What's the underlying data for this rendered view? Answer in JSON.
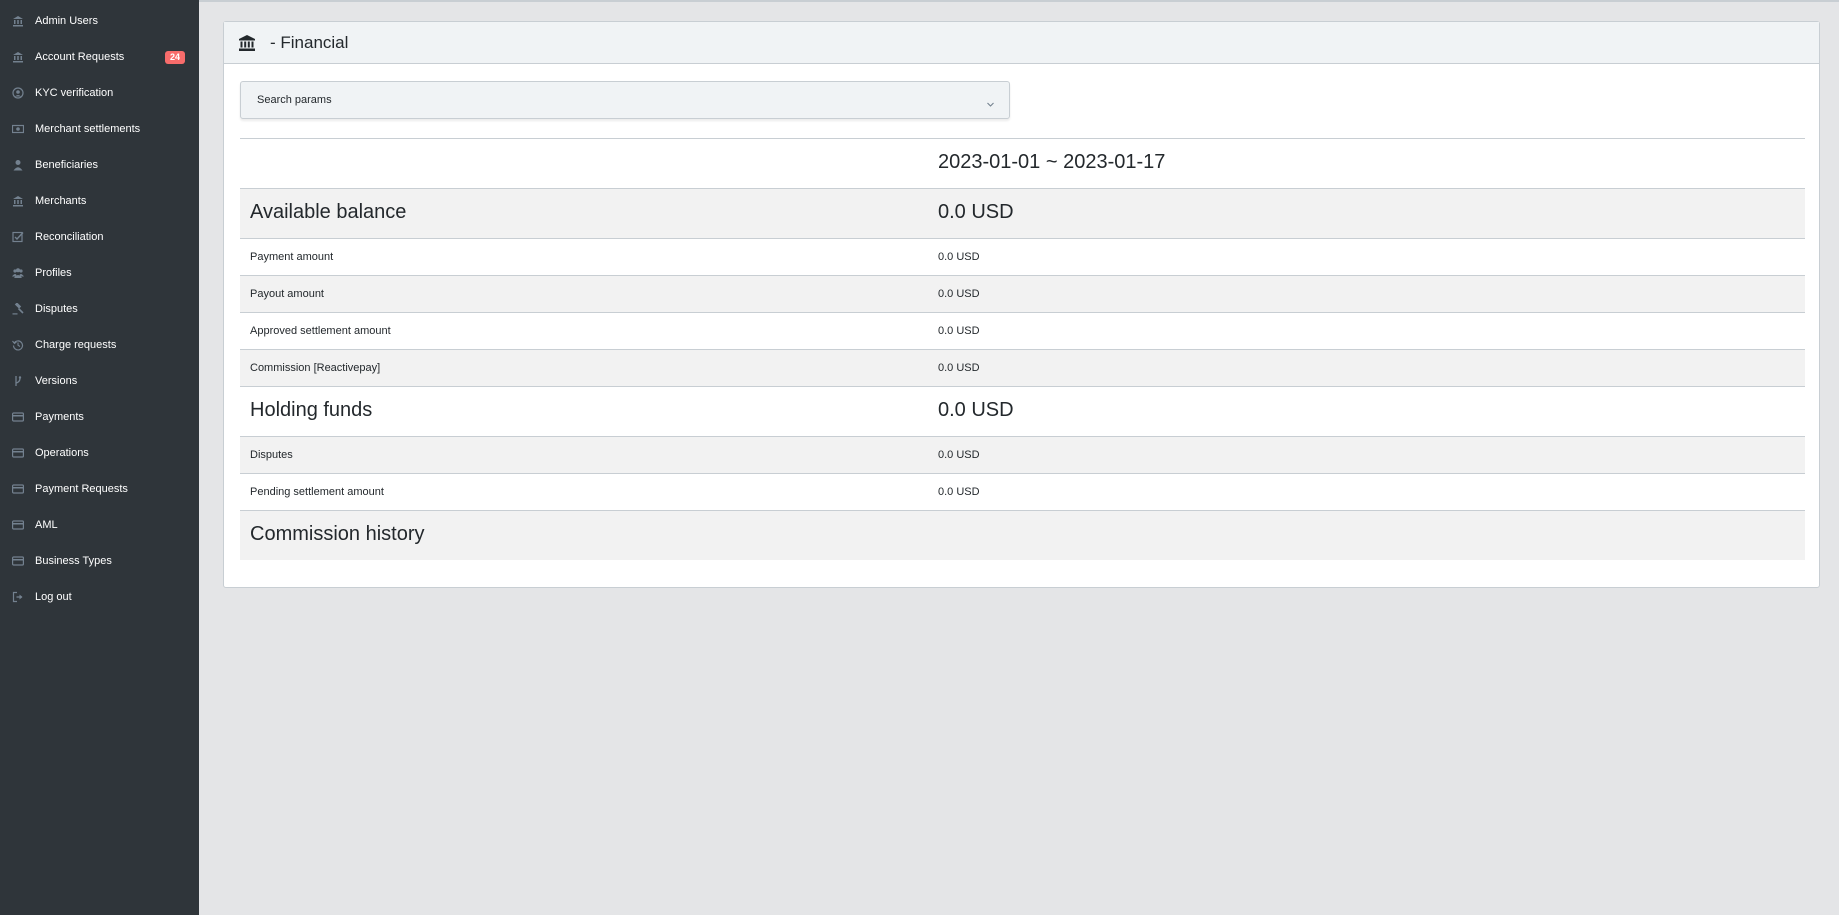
{
  "sidebar": {
    "items": [
      {
        "label": "Admin Users",
        "icon": "bank-icon"
      },
      {
        "label": "Account Requests",
        "icon": "bank-icon",
        "badge": "24"
      },
      {
        "label": "KYC verification",
        "icon": "user-circle-icon"
      },
      {
        "label": "Merchant settlements",
        "icon": "money-icon"
      },
      {
        "label": "Beneficiaries",
        "icon": "user-icon"
      },
      {
        "label": "Merchants",
        "icon": "bank-icon"
      },
      {
        "label": "Reconciliation",
        "icon": "check-square-icon"
      },
      {
        "label": "Profiles",
        "icon": "users-icon"
      },
      {
        "label": "Disputes",
        "icon": "gavel-icon"
      },
      {
        "label": "Charge requests",
        "icon": "history-icon"
      },
      {
        "label": "Versions",
        "icon": "code-branch-icon"
      },
      {
        "label": "Payments",
        "icon": "credit-card-icon"
      },
      {
        "label": "Operations",
        "icon": "credit-card-icon"
      },
      {
        "label": "Payment Requests",
        "icon": "credit-card-icon"
      },
      {
        "label": "AML",
        "icon": "credit-card-icon"
      },
      {
        "label": "Business Types",
        "icon": "credit-card-icon"
      },
      {
        "label": "Log out",
        "icon": "sign-out-icon"
      }
    ]
  },
  "card": {
    "title": "- Financial",
    "icon": "bank-icon"
  },
  "search": {
    "label": "Search params"
  },
  "table": {
    "period": "2023-01-01 ~ 2023-01-17",
    "rows": [
      {
        "label": "Available balance",
        "value": "0.0 USD",
        "size": "big"
      },
      {
        "label": "Payment amount",
        "value": "0.0 USD",
        "size": "small"
      },
      {
        "label": "Payout amount",
        "value": "0.0 USD",
        "size": "small"
      },
      {
        "label": "Approved settlement amount",
        "value": "0.0 USD",
        "size": "small"
      },
      {
        "label": "Commission [Reactivepay]",
        "value": "0.0 USD",
        "size": "small"
      },
      {
        "label": "Holding funds",
        "value": "0.0 USD",
        "size": "big"
      },
      {
        "label": "Disputes",
        "value": "0.0 USD",
        "size": "small"
      },
      {
        "label": "Pending settlement amount",
        "value": "0.0 USD",
        "size": "small"
      },
      {
        "label": "Commission history",
        "value": "",
        "size": "big"
      }
    ]
  },
  "colors": {
    "sidebar_bg": "#2f353a",
    "page_bg": "#e4e5e7",
    "badge": "#f86c6b",
    "row_alt": "#f2f2f2"
  }
}
